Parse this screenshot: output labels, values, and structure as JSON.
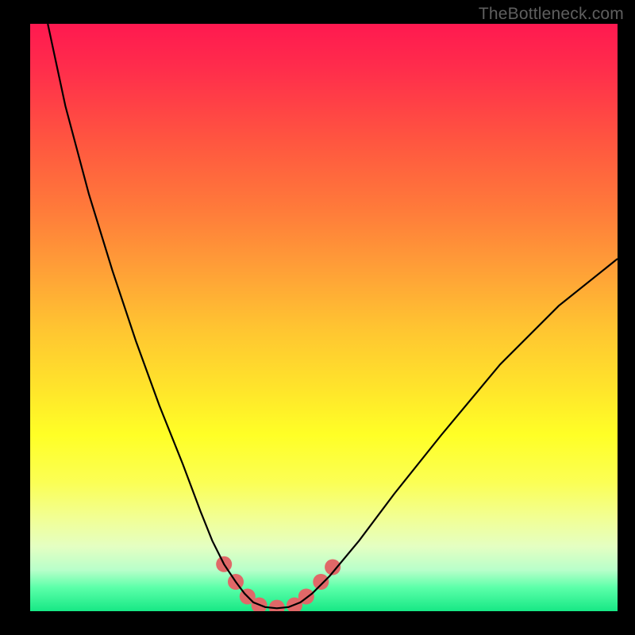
{
  "watermark": "TheBottleneck.com",
  "chart_data": {
    "type": "line",
    "title": "",
    "xlabel": "",
    "ylabel": "",
    "xlim": [
      0,
      100
    ],
    "ylim": [
      0,
      100
    ],
    "grid": false,
    "series": [
      {
        "name": "bottleneck-curve",
        "color": "#000000",
        "x": [
          3,
          6,
          10,
          14,
          18,
          22,
          26,
          29,
          31,
          33,
          35,
          36.5,
          38,
          40,
          42,
          44,
          46,
          48,
          51,
          56,
          62,
          70,
          80,
          90,
          100
        ],
        "y": [
          100,
          86,
          71,
          58,
          46,
          35,
          25,
          17,
          12,
          8,
          5,
          3,
          1.5,
          0.7,
          0.5,
          0.7,
          1.5,
          3,
          6,
          12,
          20,
          30,
          42,
          52,
          60
        ]
      }
    ],
    "markers": {
      "name": "highlight-dots",
      "color": "#e06868",
      "radius_px": 10,
      "points": [
        {
          "x": 33,
          "y": 8
        },
        {
          "x": 35,
          "y": 5
        },
        {
          "x": 37,
          "y": 2.5
        },
        {
          "x": 39,
          "y": 1
        },
        {
          "x": 42,
          "y": 0.6
        },
        {
          "x": 45,
          "y": 1
        },
        {
          "x": 47,
          "y": 2.5
        },
        {
          "x": 49.5,
          "y": 5
        },
        {
          "x": 51.5,
          "y": 7.5
        }
      ]
    }
  }
}
